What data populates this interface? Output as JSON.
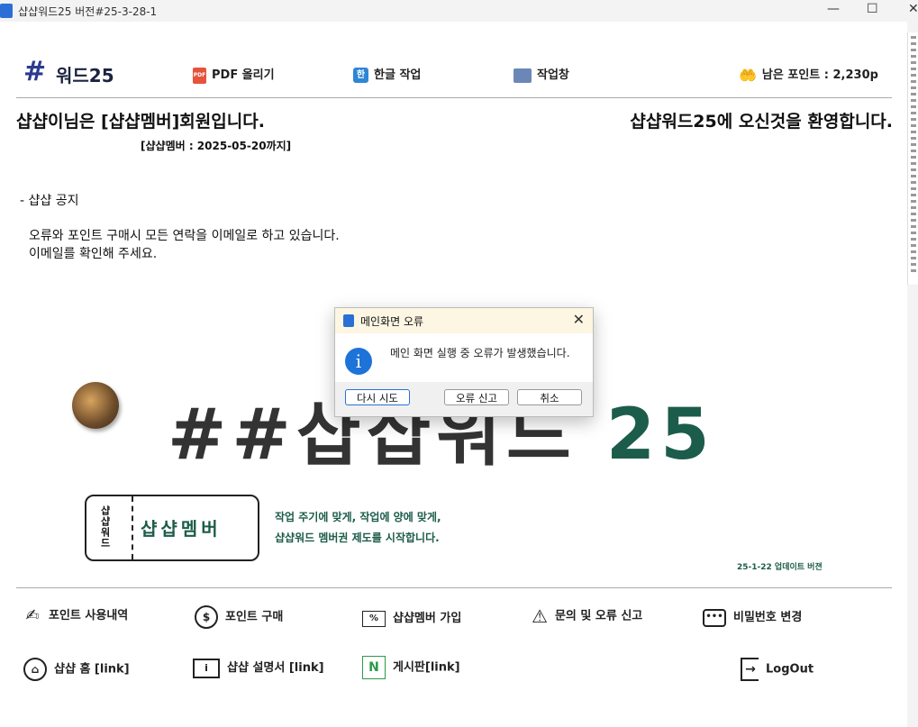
{
  "window": {
    "title": "샵샵워드25 버전#25-3-28-1",
    "minimize": "—",
    "maximize": "☐",
    "close": "✕"
  },
  "header": {
    "logo_hash": "#",
    "logo_text": "워드25",
    "pdf_label": "PDF 올리기",
    "hangul_label": "한글 작업",
    "workwin_label": "작업창",
    "points_label": "남은 포인트 : 2,230p"
  },
  "member": {
    "status": "샵샵이님은 [샵샵멤버]회원입니다.",
    "welcome": "샵샵워드25에 오신것을 환영합니다.",
    "expiry": "[샵샵멤버 : 2025-05-20까지]"
  },
  "notice": {
    "title": "- 샵샵 공지",
    "line1": "오류와 포인트 구매시 모든 연락을 이메일로 하고 있습니다.",
    "line2": "이메일를 확인해 주세요."
  },
  "banner": {
    "title_main": "##샵샵워드 ",
    "title_num": "25",
    "ticket_vertical": "샵샵워드",
    "ticket_text": "샵샵멤버",
    "tagline1": "작업 주기에 맞게, 작업에 양에 맞게,",
    "tagline2": "샵샵워드 멤버권 제도를 시작합니다.",
    "update_note": "25-1-22 업데이트 버젼"
  },
  "menu": {
    "point_history": "포인트 사용내역",
    "point_buy": "포인트 구매",
    "member_join": "샵샵멤버 가입",
    "inquiry": "문의 및 오류 신고",
    "password": "비밀번호 변경",
    "home": "샵샵 홈 [link]",
    "manual": "샵샵 설명서 [link]",
    "board": "게시판[link]",
    "logout": "LogOut"
  },
  "dialog": {
    "title": "메인화면 오류",
    "message": "메인 화면 실행 중 오류가 발생했습니다.",
    "retry": "다시 시도",
    "report": "오류 신고",
    "cancel": "취소"
  },
  "colors": {
    "accent_green": "#1c5c4a",
    "logo_blue": "#2b3a8f",
    "info_blue": "#1e73d8"
  }
}
